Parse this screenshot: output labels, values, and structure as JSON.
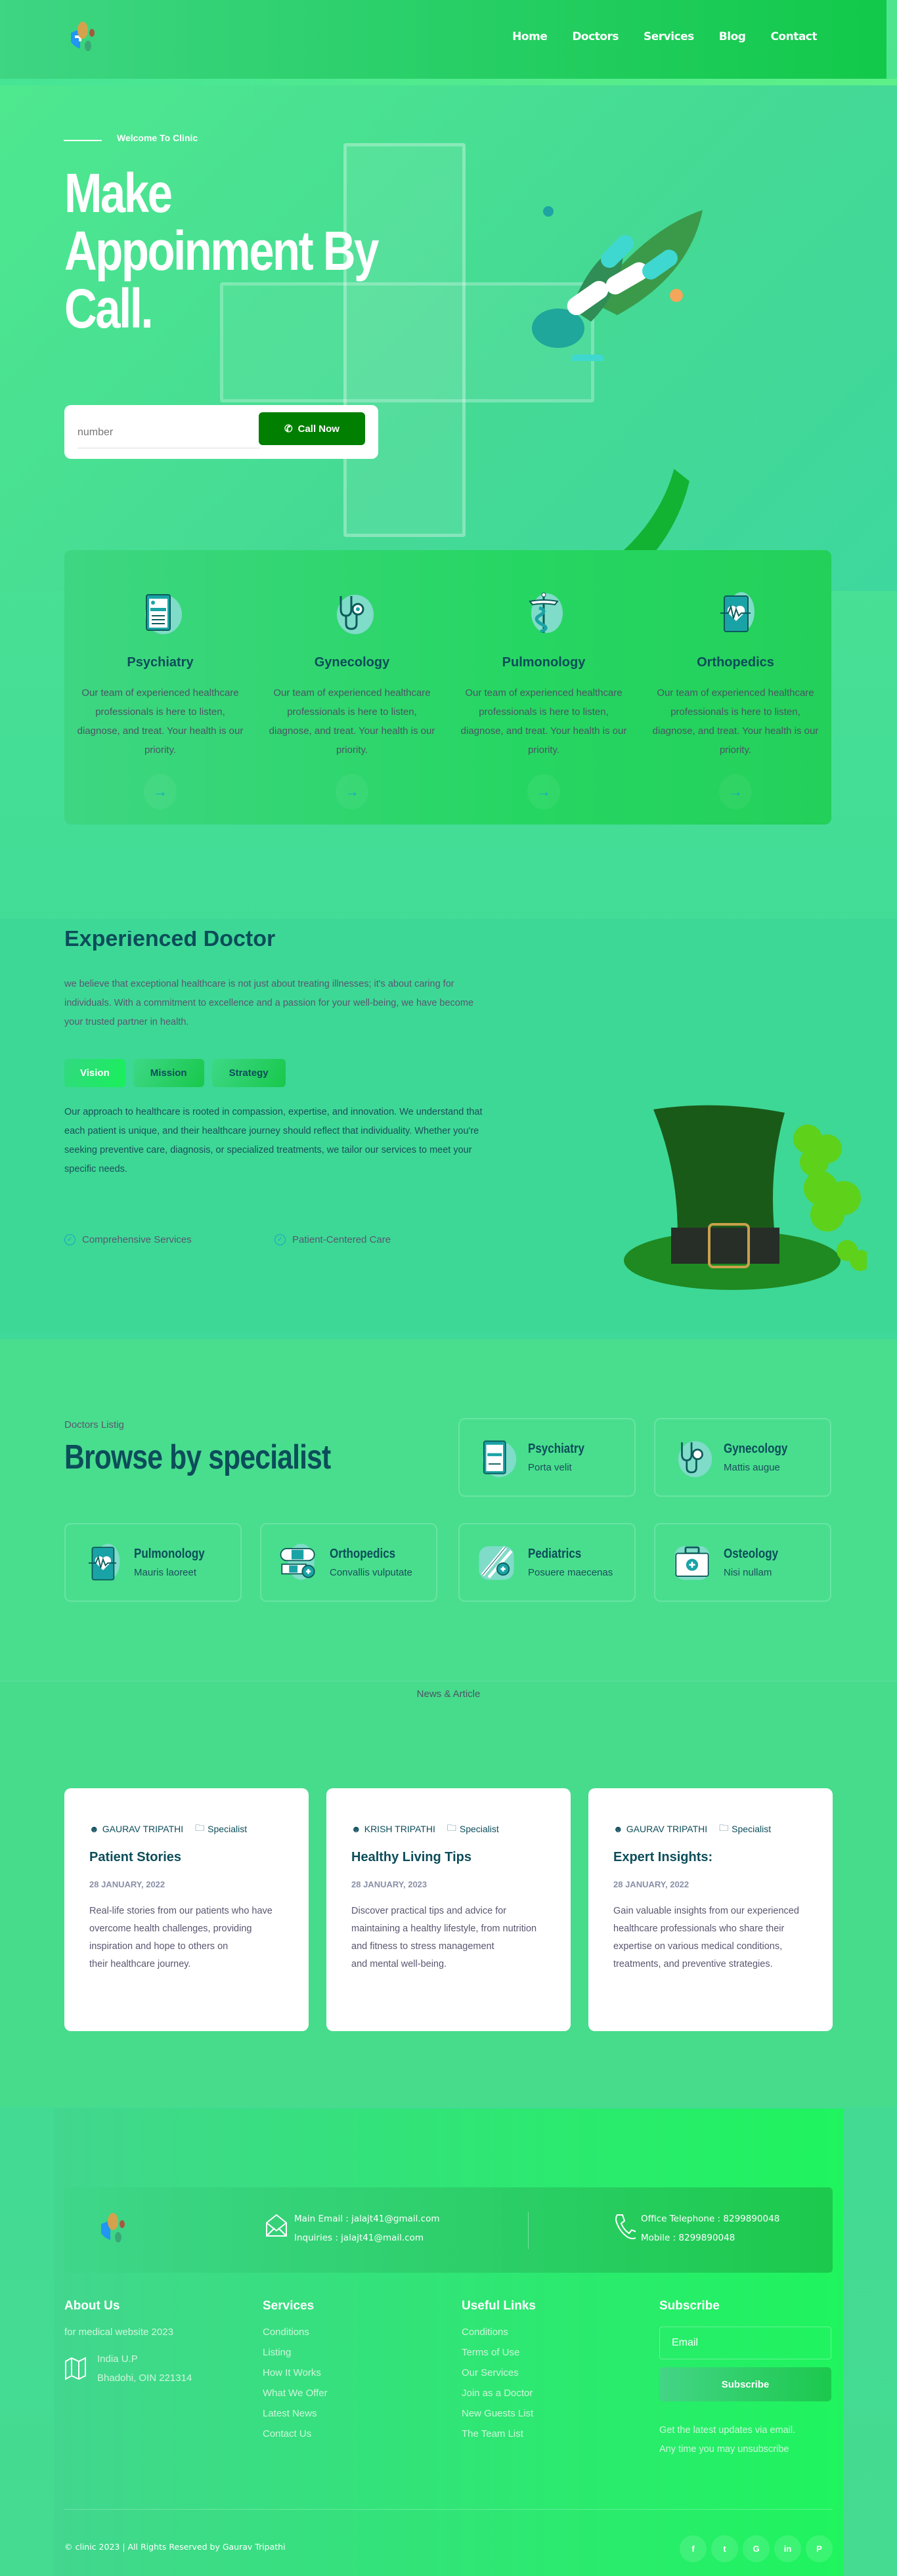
{
  "nav": {
    "items": [
      "Home",
      "Doctors",
      "Services",
      "Blog",
      "Contact"
    ]
  },
  "hero": {
    "kicker": "Welcome To Clinic",
    "title": "Make Appoinment By Call.",
    "input_placeholder": "number",
    "call_button": "Call Now"
  },
  "services": [
    {
      "icon": "clipboard-icon",
      "title": "Psychiatry",
      "text": "Our team of experienced healthcare professionals is here to listen, diagnose, and treat. Your health is our priority."
    },
    {
      "icon": "stethoscope-icon",
      "title": "Gynecology",
      "text": "Our team of experienced healthcare professionals is here to listen, diagnose, and treat. Your health is our priority."
    },
    {
      "icon": "caduceus-icon",
      "title": "Pulmonology",
      "text": "Our team of experienced healthcare professionals is here to listen, diagnose, and treat. Your health is our priority."
    },
    {
      "icon": "heart-monitor-icon",
      "title": "Orthopedics",
      "text": "Our team of experienced healthcare professionals is here to listen, diagnose, and treat. Your health is our priority."
    }
  ],
  "about": {
    "title": "Experienced Doctor",
    "intro": "we believe that exceptional healthcare is not just about treating illnesses; it's about caring for individuals. With a commitment to excellence and a passion for your well-being, we have become your trusted partner in health.",
    "tabs": [
      "Vision",
      "Mission",
      "Strategy"
    ],
    "active_tab": "Vision",
    "body": "Our approach to healthcare is rooted in compassion, expertise, and innovation. We understand that each patient is unique, and their healthcare journey should reflect that individuality. Whether you're seeking preventive care, diagnosis, or specialized treatments, we tailor our services to meet your specific needs.",
    "checks": [
      "Comprehensive Services",
      "Patient-Centered Care"
    ]
  },
  "specialists": {
    "kicker": "Doctors Listig",
    "title": "Browse by specialist",
    "items": [
      {
        "icon": "clipboard-icon",
        "name": "Psychiatry",
        "sub": "Porta velit"
      },
      {
        "icon": "stethoscope-icon",
        "name": "Gynecology",
        "sub": "Mattis augue"
      },
      {
        "icon": "heart-monitor-icon",
        "name": "Pulmonology",
        "sub": "Mauris laoreet"
      },
      {
        "icon": "bandage-icon",
        "name": "Orthopedics",
        "sub": "Convallis vulputate"
      },
      {
        "icon": "scalpel-icon",
        "name": "Pediatrics",
        "sub": "Posuere maecenas"
      },
      {
        "icon": "first-aid-kit-icon",
        "name": "Osteology",
        "sub": "Nisi nullam"
      }
    ]
  },
  "news": {
    "kicker": "News & Article",
    "items": [
      {
        "author": "GAURAV TRIPATHI",
        "category": "Specialist",
        "title": "Patient Stories",
        "date": "28 JANUARY, 2022",
        "text": "Real-life stories from our patients who have overcome health challenges, providing inspiration and hope to others on\ntheir healthcare journey."
      },
      {
        "author": "KRISH TRIPATHI",
        "category": "Specialist",
        "title": "Healthy Living Tips",
        "date": "28 JANUARY, 2023",
        "text": "Discover practical tips and advice for maintaining a healthy lifestyle, from nutrition and fitness to stress management\nand mental well-being."
      },
      {
        "author": "GAURAV TRIPATHI",
        "category": "Specialist",
        "title": "Expert Insights:",
        "date": "28 JANUARY, 2022",
        "text": "Gain valuable insights from our experienced healthcare professionals who share their expertise on various medical conditions, treatments, and preventive strategies."
      }
    ]
  },
  "footer": {
    "email_main": "Main Email : jalajt41@gmail.com",
    "email_inquiries": "Inquiries : jalajt41@mail.com",
    "office_phone": "Office Telephone : 8299890048",
    "mobile": "Mobile : 8299890048",
    "about_title": "About Us",
    "about_text": "for medical website 2023",
    "address_line1": "India U.P",
    "address_line2": "Bhadohi, OIN 221314",
    "services_title": "Services",
    "services_links": [
      "Conditions",
      "Listing",
      "How It Works",
      "What We Offer",
      "Latest News",
      "Contact Us"
    ],
    "useful_title": "Useful Links",
    "useful_links": [
      "Conditions",
      "Terms of Use",
      "Our Services",
      "Join as a Doctor",
      "New Guests List",
      "The Team List"
    ],
    "subscribe_title": "Subscribe",
    "subscribe_placeholder": "Email",
    "subscribe_button": "Subscribe",
    "subscribe_note1": "Get the latest updates via email.",
    "subscribe_note2": "Any time you may unsubscribe",
    "copyright": "© clinic 2023 | All Rights Reserved by Gaurav Tripathi",
    "socials": [
      {
        "icon": "facebook-icon",
        "glyph": "f"
      },
      {
        "icon": "twitter-icon",
        "glyph": "t"
      },
      {
        "icon": "google-icon",
        "glyph": "G"
      },
      {
        "icon": "linkedin-icon",
        "glyph": "in"
      },
      {
        "icon": "pinterest-icon",
        "glyph": "P"
      }
    ]
  }
}
